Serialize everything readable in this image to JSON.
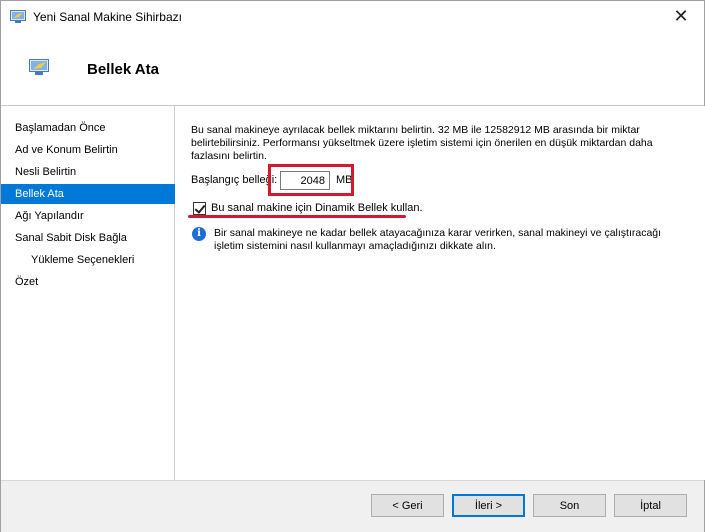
{
  "window": {
    "title": "Yeni Sanal Makine Sihirbazı"
  },
  "header": {
    "title": "Bellek Ata"
  },
  "sidebar": {
    "items": [
      {
        "label": "Başlamadan Önce"
      },
      {
        "label": "Ad ve Konum Belirtin"
      },
      {
        "label": "Nesli Belirtin"
      },
      {
        "label": "Bellek Ata"
      },
      {
        "label": "Ağı Yapılandır"
      },
      {
        "label": "Sanal Sabit Disk Bağla"
      },
      {
        "label": "Yükleme Seçenekleri"
      },
      {
        "label": "Özet"
      }
    ],
    "active_index": 3
  },
  "content": {
    "description": "Bu sanal makineye ayrılacak bellek miktarını belirtin. 32 MB ile 12582912 MB arasında bir miktar belirtebilirsiniz. Performansı yükseltmek üzere işletim sistemi için önerilen en düşük miktardan daha fazlasını belirtin.",
    "startup_memory_label": "Başlangıç belleği:",
    "startup_memory_value": "2048",
    "startup_memory_unit": "MB",
    "dynamic_memory_label": "Bu sanal makine için Dinamik Bellek kullan.",
    "dynamic_memory_checked": true,
    "info_text": "Bir sanal makineye ne kadar bellek atayacağınıza karar verirken, sanal makineyi ve çalıştıracağı işletim sistemini nasıl kullanmayı amaçladığınızı dikkate alın."
  },
  "footer": {
    "back_label": "< Geri",
    "next_label": "İleri >",
    "finish_label": "Son",
    "cancel_label": "İptal"
  },
  "colors": {
    "accent": "#0078d7",
    "highlight": "#d3182f",
    "info": "#1c6ed4"
  },
  "icons": {
    "window": "vm-wizard-icon",
    "close": "close-icon",
    "info": "info-icon"
  }
}
